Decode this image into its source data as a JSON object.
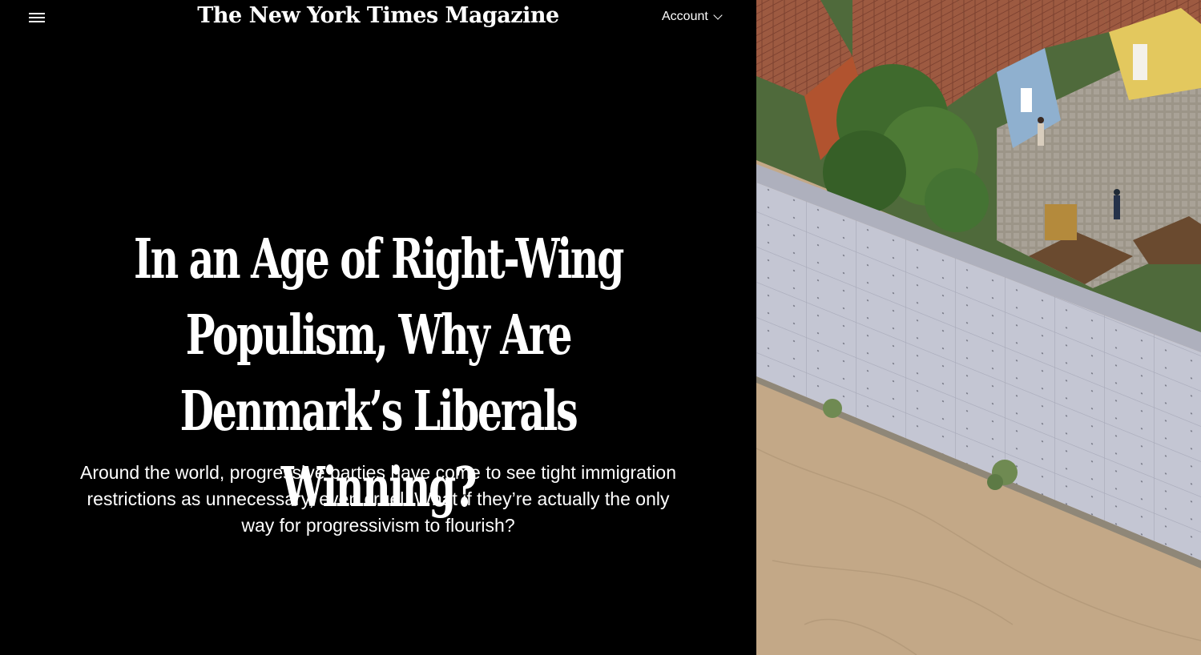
{
  "header": {
    "masthead": "The New York Times Magazine",
    "account_label": "Account"
  },
  "icons": {
    "menu": "hamburger-menu-icon",
    "account_dropdown": "chevron-down-icon"
  },
  "article": {
    "headline": "In an Age of Right-Wing Populism, Why Are Denmark’s Liberals Winning?",
    "dek": "Around the world, progressive parties have come to see tight immigration restrictions as unnecessary, even cruel. What if they’re actually the only way for progressivism to flourish?"
  },
  "colors": {
    "background": "#000000",
    "text": "#ffffff"
  }
}
